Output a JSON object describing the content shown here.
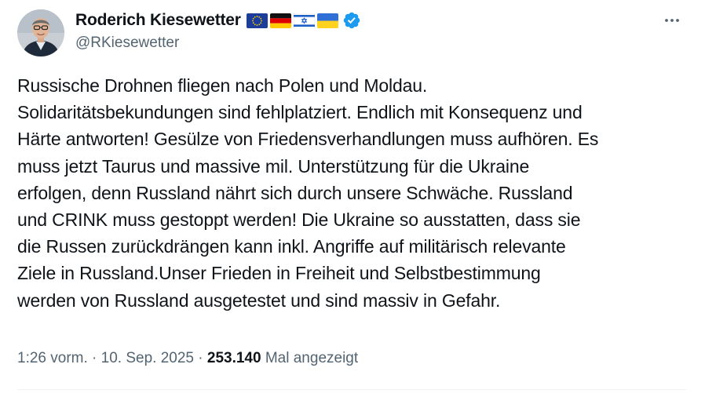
{
  "author": {
    "display_name": "Roderich Kiesewetter",
    "handle": "@RKiesewetter",
    "flags": [
      "eu-flag",
      "germany-flag",
      "israel-flag",
      "ukraine-flag"
    ],
    "verified": true
  },
  "tweet": {
    "text": "Russische Drohnen fliegen nach Polen und Moldau.\nSolidaritätsbekundungen sind fehlplatziert. Endlich mit Konsequenz und\nHärte antworten! Gesülze von Friedensverhandlungen muss aufhören. Es\nmuss jetzt Taurus und massive mil. Unterstützung für die Ukraine\nerfolgen, denn Russland nährt sich durch unsere Schwäche. Russland\nund CRINK muss gestoppt werden! Die Ukraine so ausstatten, dass sie\ndie Russen zurückdrängen kann inkl. Angriffe auf militärisch relevante\nZiele in Russland.Unser Frieden in Freiheit und Selbstbestimmung\nwerden von Russland ausgetestet und sind massiv in Gefahr."
  },
  "meta": {
    "time": "1:26 vorm.",
    "separator": "·",
    "date": "10. Sep. 2025",
    "views": "253.140",
    "views_label": "Mal angezeigt"
  },
  "colors": {
    "verified_blue": "#1d9bf0",
    "secondary_text": "#536471",
    "primary_text": "#0f1419"
  },
  "icons": {
    "more": "more-horizontal-icon",
    "verified": "verified-badge-icon"
  }
}
